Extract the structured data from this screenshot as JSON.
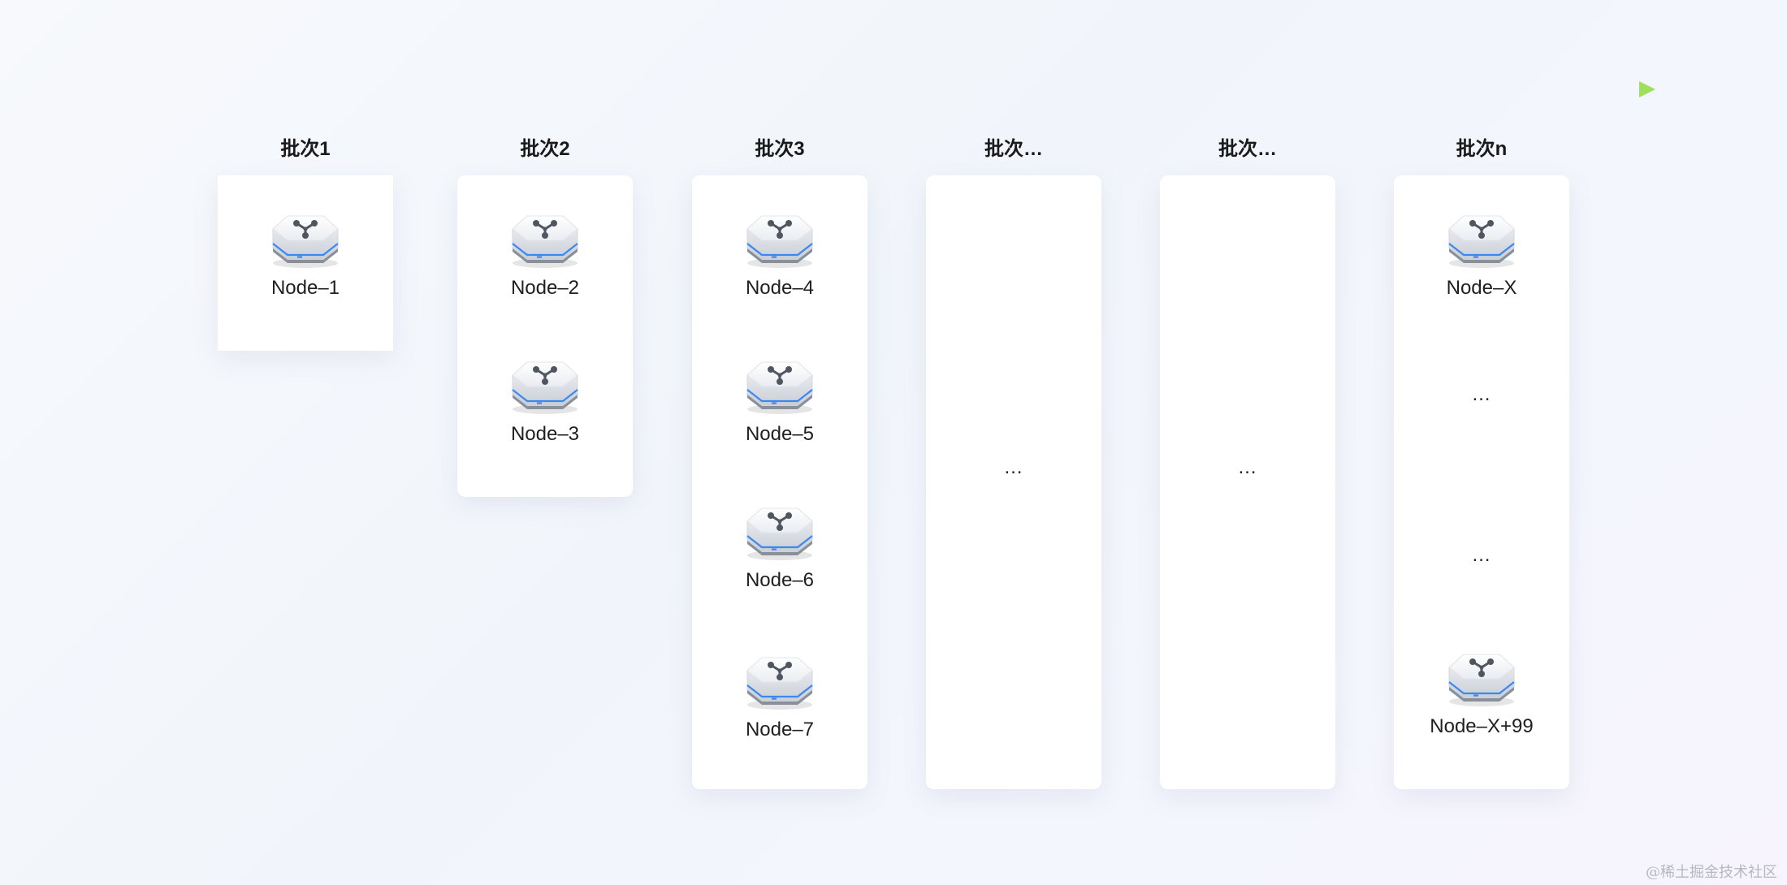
{
  "batches": [
    {
      "label": "批次1"
    },
    {
      "label": "批次2"
    },
    {
      "label": "批次3"
    },
    {
      "label": "批次…"
    },
    {
      "label": "批次…"
    },
    {
      "label": "批次n"
    }
  ],
  "nodes": {
    "node1": "Node–1",
    "node2": "Node–2",
    "node3": "Node–3",
    "node4": "Node–4",
    "node5": "Node–5",
    "node6": "Node–6",
    "node7": "Node–7",
    "nodeX": "Node–X",
    "nodeX99": "Node–X+99"
  },
  "ellipsis": "…",
  "watermark": "@稀土掘金技术社区",
  "colors": {
    "arrow_start": "#dfe2f4",
    "arrow_mid": "#4a98dc",
    "arrow_end": "#9fdf5c",
    "card": "#ffffff",
    "node_accent": "#3a88f0"
  },
  "icons": {
    "node": "server-node-icon"
  }
}
